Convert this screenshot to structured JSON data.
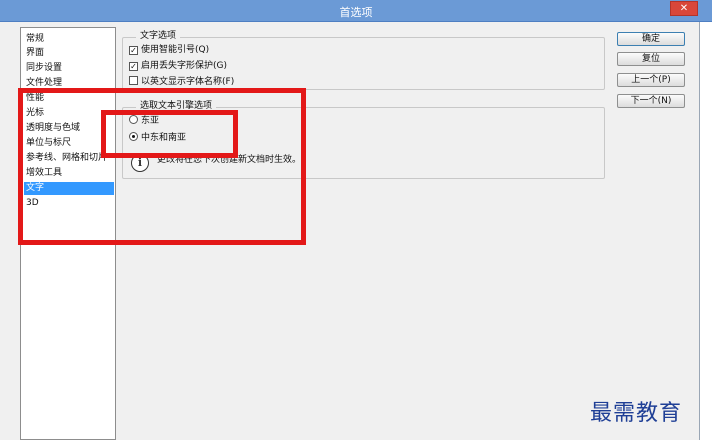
{
  "window": {
    "title": "首选项",
    "close_glyph": "✕"
  },
  "sidebar": {
    "items": [
      {
        "label": "常规",
        "active": false
      },
      {
        "label": "界面",
        "active": false
      },
      {
        "label": "同步设置",
        "active": false
      },
      {
        "label": "文件处理",
        "active": false
      },
      {
        "label": "性能",
        "active": false
      },
      {
        "label": "光标",
        "active": false
      },
      {
        "label": "透明度与色域",
        "active": false
      },
      {
        "label": "单位与标尺",
        "active": false
      },
      {
        "label": "参考线、网格和切片",
        "active": false
      },
      {
        "label": "增效工具",
        "active": false
      },
      {
        "label": "文字",
        "active": true
      },
      {
        "label": "3D",
        "active": false
      }
    ]
  },
  "text_options": {
    "legend": "文字选项",
    "items": [
      {
        "label": "使用智能引号(Q)",
        "checked": true
      },
      {
        "label": "启用丢失字形保护(G)",
        "checked": true
      },
      {
        "label": "以英文显示字体名称(F)",
        "checked": false
      }
    ]
  },
  "engine_options": {
    "legend": "选取文本引擎选项",
    "items": [
      {
        "label": "东亚",
        "selected": false
      },
      {
        "label": "中东和南亚",
        "selected": true
      }
    ],
    "info_glyph": "i",
    "info_text": "更改将在您下次创建新文档时生效。"
  },
  "buttons": {
    "ok": "确定",
    "reset": "复位",
    "prev": "上一个(P)",
    "next": "下一个(N)"
  },
  "watermark": "最需教育",
  "colors": {
    "titlebar": "#6b9ad6",
    "selection": "#3399ff",
    "highlight_box": "#e31818",
    "watermark": "#1f3f96"
  }
}
